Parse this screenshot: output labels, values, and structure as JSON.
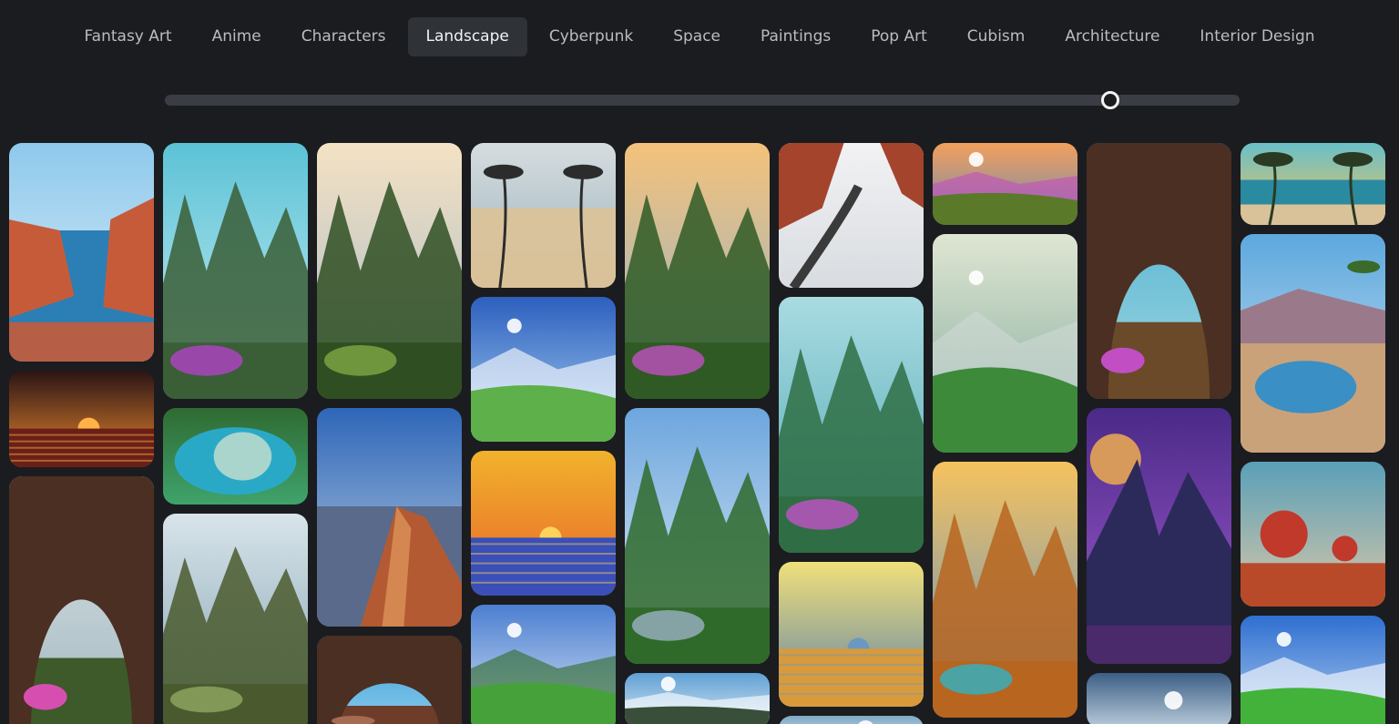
{
  "categories": [
    {
      "label": "Fantasy Art",
      "active": false
    },
    {
      "label": "Anime",
      "active": false
    },
    {
      "label": "Characters",
      "active": false
    },
    {
      "label": "Landscape",
      "active": true
    },
    {
      "label": "Cyberpunk",
      "active": false
    },
    {
      "label": "Space",
      "active": false
    },
    {
      "label": "Paintings",
      "active": false
    },
    {
      "label": "Pop Art",
      "active": false
    },
    {
      "label": "Cubism",
      "active": false
    },
    {
      "label": "Architecture",
      "active": false
    },
    {
      "label": "Interior Design",
      "active": false
    }
  ],
  "slider": {
    "value": 0.88
  },
  "colors": {
    "background": "#1b1c1f",
    "tab_text": "#b9bcc3",
    "tab_active_bg": "#2f3237",
    "slider_track": "#3a3d43",
    "slider_thumb": "#f4f4f4"
  },
  "gallery": {
    "columns": [
      [
        {
          "subject": "coastal-canyon",
          "sky": [
            "#8ec9ec",
            "#dfeef8"
          ],
          "ground": "#c65b3a",
          "accent": "#2b7fb4",
          "shape": "cliffs"
        },
        {
          "subject": "ocean-sunset",
          "sky": [
            "#2a1416",
            "#f08a2c"
          ],
          "ground": "#6a1f18",
          "accent": "#ffb347",
          "shape": "sunset"
        },
        {
          "subject": "cave-valley",
          "sky": [
            "#dfe6e8",
            "#9fb6be"
          ],
          "ground": "#3e5a2a",
          "accent": "#d64fb0",
          "shape": "cave"
        }
      ],
      [
        {
          "subject": "purple-flower-canyon",
          "sky": [
            "#5cc2d6",
            "#c9eef3"
          ],
          "ground": "#3a5e36",
          "accent": "#b142c8",
          "shape": "peaks"
        },
        {
          "subject": "tropical-lagoon",
          "sky": [
            "#2f6b32",
            "#3fa36c"
          ],
          "ground": "#2aa9c6",
          "accent": "#dfe8d0",
          "shape": "lagoon"
        },
        {
          "subject": "misty-cliffs",
          "sky": [
            "#d8e4ea",
            "#7f9fae"
          ],
          "ground": "#4a5a2e",
          "accent": "#8fa860",
          "shape": "peaks"
        }
      ],
      [
        {
          "subject": "forest-cliffs-sunrise",
          "sky": [
            "#f4e2c4",
            "#a7b9c6"
          ],
          "ground": "#2f4f22",
          "accent": "#7fa844",
          "shape": "peaks"
        },
        {
          "subject": "red-rock-canyon",
          "sky": [
            "#2e66b8",
            "#c2d4e4"
          ],
          "ground": "#b35a33",
          "accent": "#e39a5c",
          "shape": "rock"
        },
        {
          "subject": "floating-rock",
          "sky": [
            "#3a9bd8",
            "#8fd0ef"
          ],
          "ground": "#6d3d2a",
          "accent": "#a66b50",
          "shape": "cave"
        }
      ],
      [
        {
          "subject": "palm-beach-waves",
          "sky": [
            "#d6dde0",
            "#9ab0b9"
          ],
          "ground": "#d8c39d",
          "accent": "#2c2c2c",
          "shape": "palms"
        },
        {
          "subject": "green-valley-sunburst",
          "sky": [
            "#2d5fbe",
            "#a8d2f2"
          ],
          "ground": "#5db04a",
          "accent": "#ffffff",
          "shape": "valley"
        },
        {
          "subject": "sunset-sea",
          "sky": [
            "#f1b22c",
            "#e7652a"
          ],
          "ground": "#3a4fb7",
          "accent": "#ffd25a",
          "shape": "sunset"
        },
        {
          "subject": "river-meadow",
          "sky": [
            "#4c7fd1",
            "#dfe9f5"
          ],
          "ground": "#47a13b",
          "accent": "#2f6b27",
          "shape": "valley"
        }
      ],
      [
        {
          "subject": "golden-valley-lake",
          "sky": [
            "#f4c27a",
            "#8fb3cf"
          ],
          "ground": "#2f5a24",
          "accent": "#c14fc1",
          "shape": "peaks"
        },
        {
          "subject": "alpine-forest",
          "sky": [
            "#6da6de",
            "#e4eef5"
          ],
          "ground": "#2f6a2b",
          "accent": "#9bb2c4",
          "shape": "peaks"
        },
        {
          "subject": "sun-over-mountains",
          "sky": [
            "#5fa0d4",
            "#dde9f1"
          ],
          "ground": "#3a4f3a",
          "accent": "#ffffff",
          "shape": "valley"
        }
      ],
      [
        {
          "subject": "snowy-canyon-road",
          "sky": [
            "#f2f2f4",
            "#d8dce0"
          ],
          "ground": "#a5442d",
          "accent": "#3a3a3a",
          "shape": "snow"
        },
        {
          "subject": "teal-mountains-flowers",
          "sky": [
            "#a9dbe2",
            "#4fa7b1"
          ],
          "ground": "#2f6e44",
          "accent": "#c251c8",
          "shape": "peaks"
        },
        {
          "subject": "calm-beach",
          "sky": [
            "#f0e07a",
            "#5c7fa8"
          ],
          "ground": "#d99a3b",
          "accent": "#6b98c2",
          "shape": "sunset"
        },
        {
          "subject": "pale-sky",
          "sky": [
            "#7fa9c4",
            "#cfe0ea"
          ],
          "ground": "#7fa9c4",
          "accent": "#ffffff",
          "shape": "plain"
        }
      ],
      [
        {
          "subject": "highland-lake",
          "sky": [
            "#f3a05c",
            "#6b88b4"
          ],
          "ground": "#5a7a2a",
          "accent": "#c24fc0",
          "shape": "valley"
        },
        {
          "subject": "green-river-valley",
          "sky": [
            "#dfe6d2",
            "#7ea79a"
          ],
          "ground": "#3c8a3a",
          "accent": "#cfd9d6",
          "shape": "valley"
        },
        {
          "subject": "autumn-river-sunset",
          "sky": [
            "#f6c25e",
            "#5b8fc7"
          ],
          "ground": "#b8651f",
          "accent": "#2fb3c4",
          "shape": "peaks"
        }
      ],
      [
        {
          "subject": "cave-arch-cliffs",
          "sky": [
            "#3fa9c7",
            "#9fd6e4"
          ],
          "ground": "#6b4a2a",
          "accent": "#c14fc3",
          "shape": "cave"
        },
        {
          "subject": "purple-planet-peaks",
          "sky": [
            "#4a2a88",
            "#a35bd0"
          ],
          "ground": "#2c2a5a",
          "accent": "#d89a5a",
          "shape": "planet"
        },
        {
          "subject": "bright-sun-horizon",
          "sky": [
            "#3c5e86",
            "#b9cbd9"
          ],
          "ground": "#22324a",
          "accent": "#ffffff",
          "shape": "plain"
        }
      ],
      [
        {
          "subject": "palm-sunset-beach",
          "sky": [
            "#69c0c8",
            "#f2c25a"
          ],
          "ground": "#2a8aa0",
          "accent": "#2a3a22",
          "shape": "palms"
        },
        {
          "subject": "desert-oasis",
          "sky": [
            "#5ca8de",
            "#d6e6f1"
          ],
          "ground": "#c9a27a",
          "accent": "#3a6b2a",
          "shape": "oasis"
        },
        {
          "subject": "red-fruit-trees",
          "sky": [
            "#5a9fb8",
            "#d9c7a8"
          ],
          "ground": "#b84a2a",
          "accent": "#c0392b",
          "shape": "trees"
        },
        {
          "subject": "green-meadow-sky",
          "sky": [
            "#2f6fd1",
            "#b7d2ef"
          ],
          "ground": "#43b23a",
          "accent": "#ffffff",
          "shape": "valley"
        }
      ]
    ]
  }
}
